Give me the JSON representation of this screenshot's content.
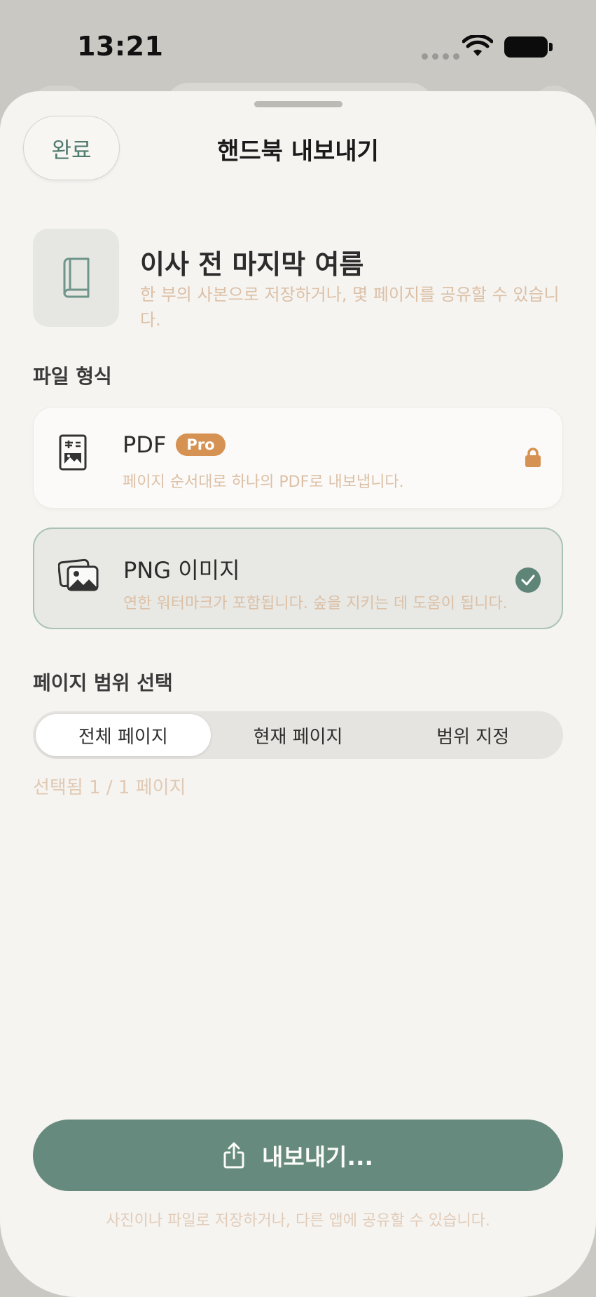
{
  "status_bar": {
    "time": "13:21"
  },
  "header": {
    "done_label": "완료",
    "title": "핸드북 내보내기"
  },
  "book": {
    "title": "이사 전 마지막 여름",
    "subtitle": "한 부의 사본으로 저장하거나, 몇 페이지를 공유할 수 있습니다.",
    "icon": "book-icon"
  },
  "file_format": {
    "label": "파일 형식",
    "options": [
      {
        "name": "PDF",
        "badge": "Pro",
        "description": "페이지 순서대로 하나의 PDF로 내보냅니다.",
        "icon": "pdf-document-icon",
        "state": "locked"
      },
      {
        "name": "PNG 이미지",
        "description": "연한 워터마크가 포함됩니다. 숲을 지키는 데 도움이 됩니다.",
        "icon": "image-stack-icon",
        "state": "selected"
      }
    ]
  },
  "page_range": {
    "label": "페이지 범위 선택",
    "segments": [
      "전체 페이지",
      "현재 페이지",
      "범위 지정"
    ],
    "selected_index": 0,
    "selected_text": "선택됨 1 / 1 페이지"
  },
  "export": {
    "button_label": "내보내기...",
    "note": "사진이나 파일로 저장하거나, 다른 앱에 공유할 수 있습니다."
  },
  "colors": {
    "accent": "#668a7d",
    "pro_badge": "#d69252",
    "muted_text": "#dcc0a6",
    "sheet_background": "#f5f4f1"
  }
}
